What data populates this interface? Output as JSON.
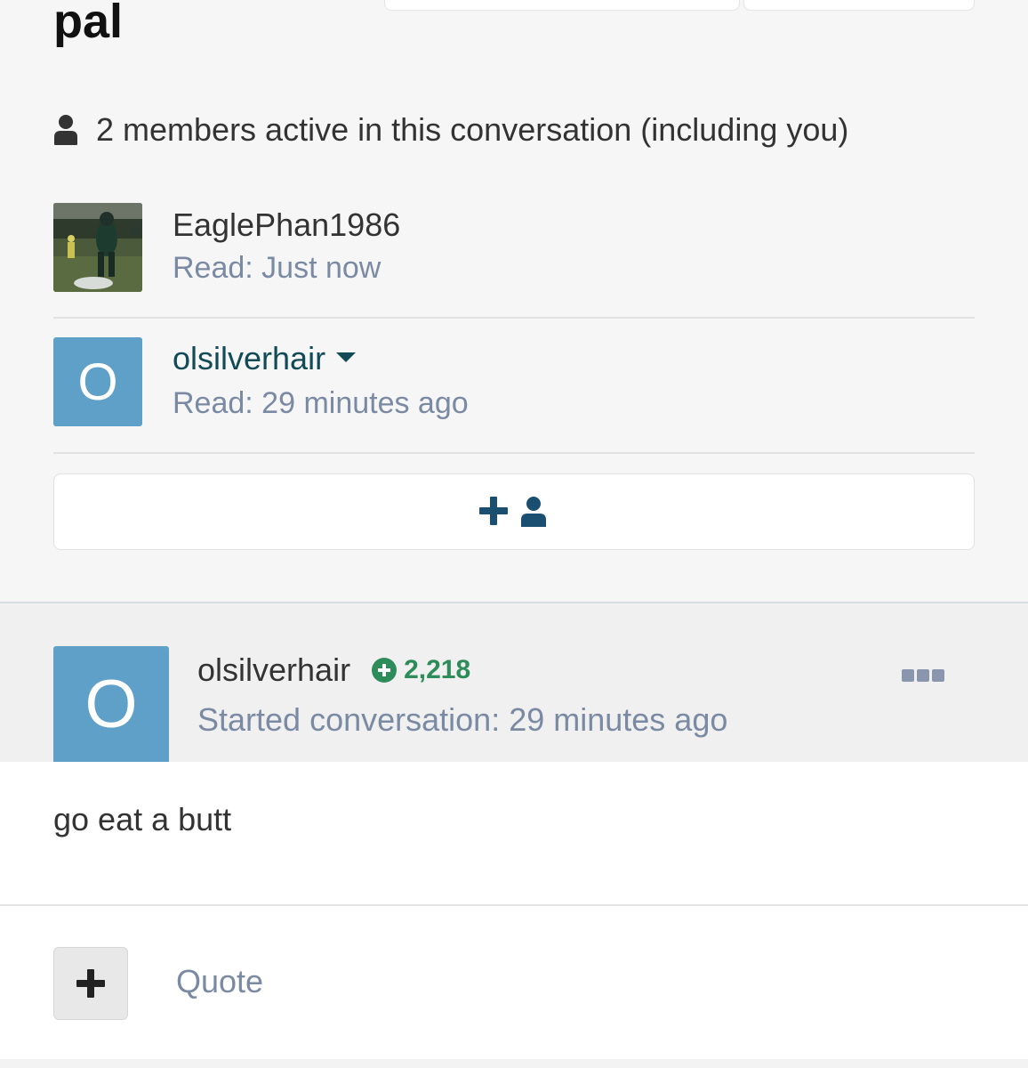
{
  "conversation": {
    "title_partial": "pal",
    "members_summary": "2 members active in this conversation (including you)"
  },
  "members": [
    {
      "name": "EaglePhan1986",
      "read_status": "Read: Just now",
      "avatar": "photo"
    },
    {
      "name": "olsilverhair",
      "read_status": "Read: 29 minutes ago",
      "avatar_letter": "O"
    }
  ],
  "add_member": {
    "icon": "plus-user-icon"
  },
  "post": {
    "author": "olsilverhair",
    "reputation": "2,218",
    "avatar_letter": "O",
    "started": "Started conversation: 29 minutes ago",
    "body": "go eat a butt"
  },
  "footer": {
    "quote_label": "Quote"
  },
  "colors": {
    "avatar_bg": "#5fa0c8",
    "link": "#124a55",
    "muted": "#7b8aa3",
    "reputation": "#2e8c5a",
    "add_icon": "#1b4f72"
  }
}
